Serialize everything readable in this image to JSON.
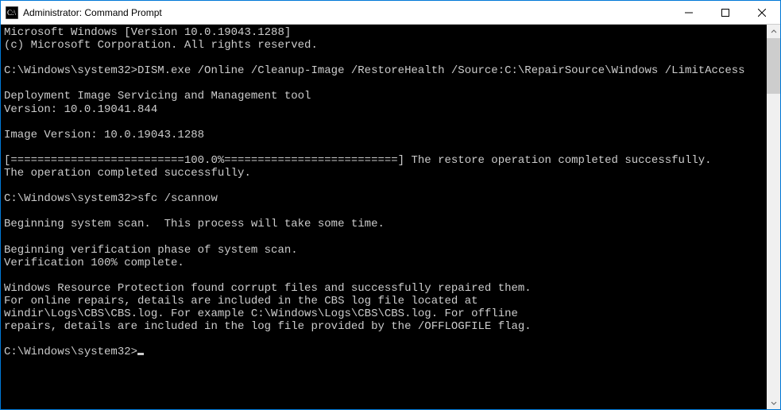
{
  "titlebar": {
    "title": "Administrator: Command Prompt"
  },
  "console": {
    "line1": "Microsoft Windows [Version 10.0.19043.1288]",
    "line2": "(c) Microsoft Corporation. All rights reserved.",
    "blank1": "",
    "prompt1": "C:\\Windows\\system32>DISM.exe /Online /Cleanup-Image /RestoreHealth /Source:C:\\RepairSource\\Windows /LimitAccess",
    "blank2": "",
    "dism1": "Deployment Image Servicing and Management tool",
    "dism2": "Version: 10.0.19041.844",
    "blank3": "",
    "imgver": "Image Version: 10.0.19043.1288",
    "blank4": "",
    "progress": "[==========================100.0%==========================] The restore operation completed successfully.",
    "opcomplete": "The operation completed successfully.",
    "blank5": "",
    "prompt2": "C:\\Windows\\system32>sfc /scannow",
    "blank6": "",
    "scan1": "Beginning system scan.  This process will take some time.",
    "blank7": "",
    "scan2": "Beginning verification phase of system scan.",
    "scan3": "Verification 100% complete.",
    "blank8": "",
    "wrp1": "Windows Resource Protection found corrupt files and successfully repaired them.",
    "wrp2": "For online repairs, details are included in the CBS log file located at",
    "wrp3": "windir\\Logs\\CBS\\CBS.log. For example C:\\Windows\\Logs\\CBS\\CBS.log. For offline",
    "wrp4": "repairs, details are included in the log file provided by the /OFFLOGFILE flag.",
    "blank9": "",
    "prompt3": "C:\\Windows\\system32>"
  }
}
